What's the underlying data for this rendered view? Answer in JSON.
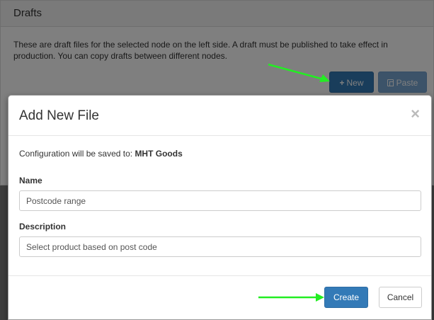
{
  "panel": {
    "title": "Drafts",
    "description": "These are draft files for the selected node on the left side. A draft must be published to take effect in production. You can copy drafts between different nodes.",
    "new_button": {
      "icon": "plus-icon",
      "label": "New"
    },
    "paste_button": {
      "icon": "paste-icon",
      "label": "Paste"
    }
  },
  "modal": {
    "title": "Add New File",
    "close_glyph": "×",
    "save_note_prefix": "Configuration will be saved to:",
    "save_target": "MHT Goods",
    "name_label": "Name",
    "name_value": "Postcode range",
    "description_label": "Description",
    "description_value": "Select product based on post code",
    "create_label": "Create",
    "cancel_label": "Cancel"
  },
  "colors": {
    "primary": "#337ab7",
    "annotation_arrow": "#22ee22"
  }
}
